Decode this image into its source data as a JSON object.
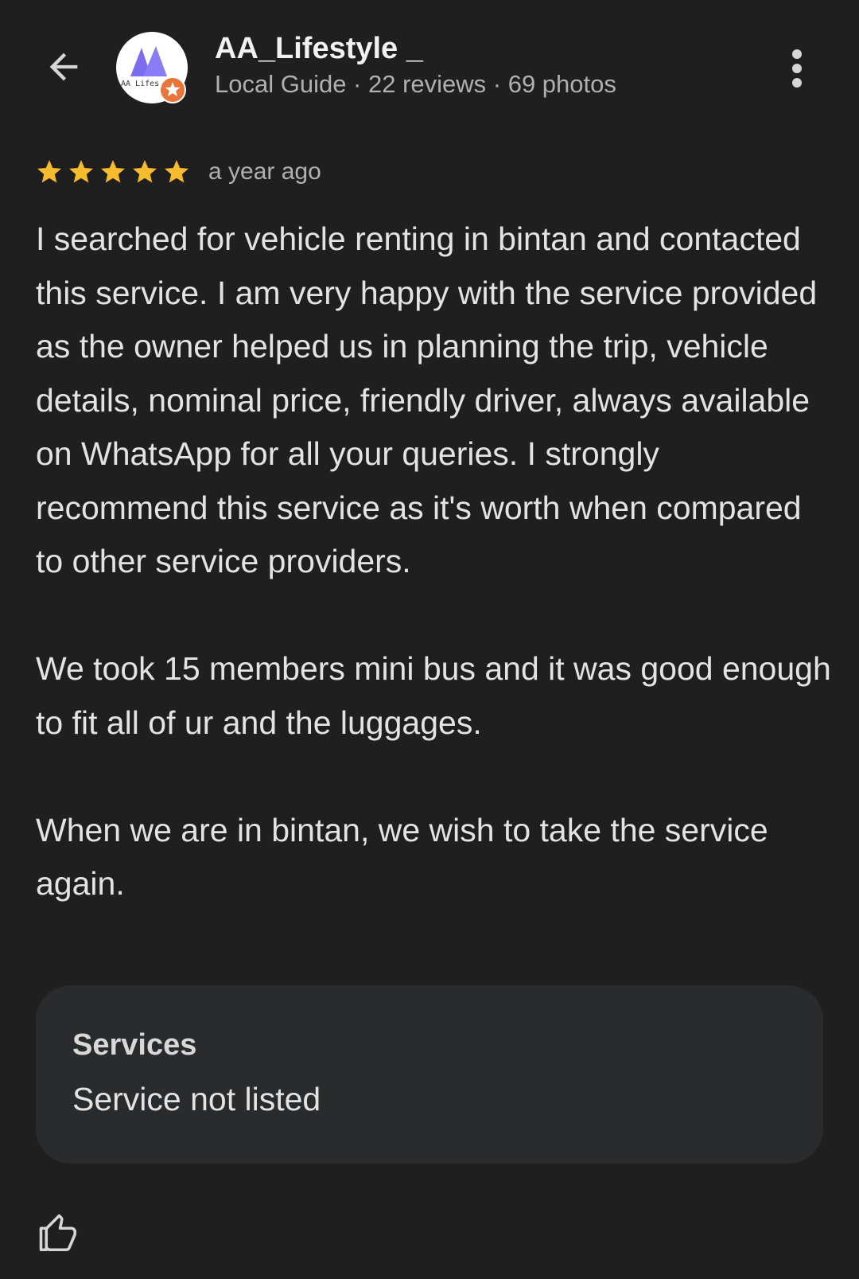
{
  "header": {
    "user_name": "AA_Lifestyle _",
    "user_meta": "Local Guide · 22 reviews · 69 photos",
    "avatar_text": "AA Lifes",
    "icons": {
      "back": "arrow-back-icon",
      "more": "more-vert-icon",
      "badge": "local-guide-star-icon"
    }
  },
  "review": {
    "rating": 5,
    "rating_max": 5,
    "time_ago": "a year ago",
    "paragraphs": [
      "I searched for vehicle renting in bintan and contacted this service. I am very happy with the service provided as the owner helped us in planning the trip, vehicle details, nominal price, friendly driver, always available on WhatsApp for all your queries. I strongly recommend this service as it's worth when compared to other service providers.",
      "We took 15 members mini bus and it was good enough to fit all of ur and the luggages.",
      "When we are in bintan, we wish to take the service again."
    ]
  },
  "services": {
    "title": "Services",
    "value": "Service not listed"
  },
  "actions": {
    "like_icon": "thumb-up-icon"
  },
  "colors": {
    "background": "#1f1f1f",
    "card": "#2a2b2d",
    "star": "#f7bb2e",
    "badge": "#e8753a",
    "logo": "#7b6cf0"
  }
}
